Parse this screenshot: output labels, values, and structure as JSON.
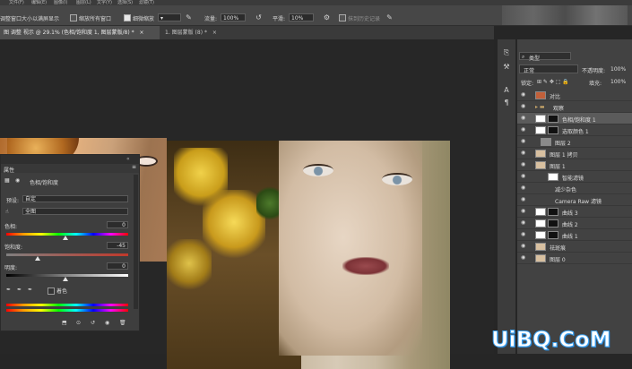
{
  "options_bar": {
    "fit_window_label": "调整窗口大小以满屏显示",
    "zoom_all_label": "缩放所有窗口",
    "scrubby_zoom_label": "细微缩放",
    "opacity_label": "流量:",
    "opacity_value": "100%",
    "flow_label": "平滑:",
    "flow_value": "10%",
    "erase_history_label": "抹到历史记录"
  },
  "tabs": [
    {
      "label": "图 调整 视示 @ 29.1% (色相/饱和度 1, 图层蒙版/8) *",
      "active": true
    },
    {
      "label": "1. 图层蒙版 (8) *",
      "active": false
    }
  ],
  "properties_panel": {
    "title": "属性",
    "adjust_name": "色相/饱和度",
    "preset_label": "预设:",
    "preset_value": "自定",
    "channel_value": "全图",
    "hue_label": "色相:",
    "hue_value": "0",
    "saturation_label": "饱和度:",
    "saturation_value": "-45",
    "lightness_label": "明度:",
    "lightness_value": "0",
    "colorize_label": "着色"
  },
  "layers_panel": {
    "kind_label": "类型",
    "blend_mode": "正常",
    "opacity_label": "不透明度:",
    "opacity_value": "100%",
    "lock_label": "锁定:",
    "fill_label": "填充:",
    "fill_value": "100%",
    "layers": [
      {
        "name": "对比",
        "selected": false
      },
      {
        "name": "观察",
        "selected": false
      },
      {
        "name": "色相/饱和度 1",
        "selected": true
      },
      {
        "name": "选取颜色 1",
        "selected": false
      },
      {
        "name": "图层 2",
        "selected": false
      },
      {
        "name": "图层 1 拷贝",
        "selected": false
      },
      {
        "name": "图层 1",
        "selected": false
      },
      {
        "name": "智能滤镜",
        "selected": false
      },
      {
        "name": "减少杂色",
        "selected": false
      },
      {
        "name": "Camera Raw 滤镜",
        "selected": false
      },
      {
        "name": "曲线 3",
        "selected": false
      },
      {
        "name": "曲线 2",
        "selected": false
      },
      {
        "name": "曲线 1",
        "selected": false
      },
      {
        "name": "祛斑痕",
        "selected": false
      },
      {
        "name": "图层 0",
        "selected": false
      }
    ]
  },
  "watermark": "UiBQ.CoM",
  "colors": {
    "accent": "#3ea2f0",
    "panel": "#424242",
    "selected": "#5b5b5b"
  }
}
